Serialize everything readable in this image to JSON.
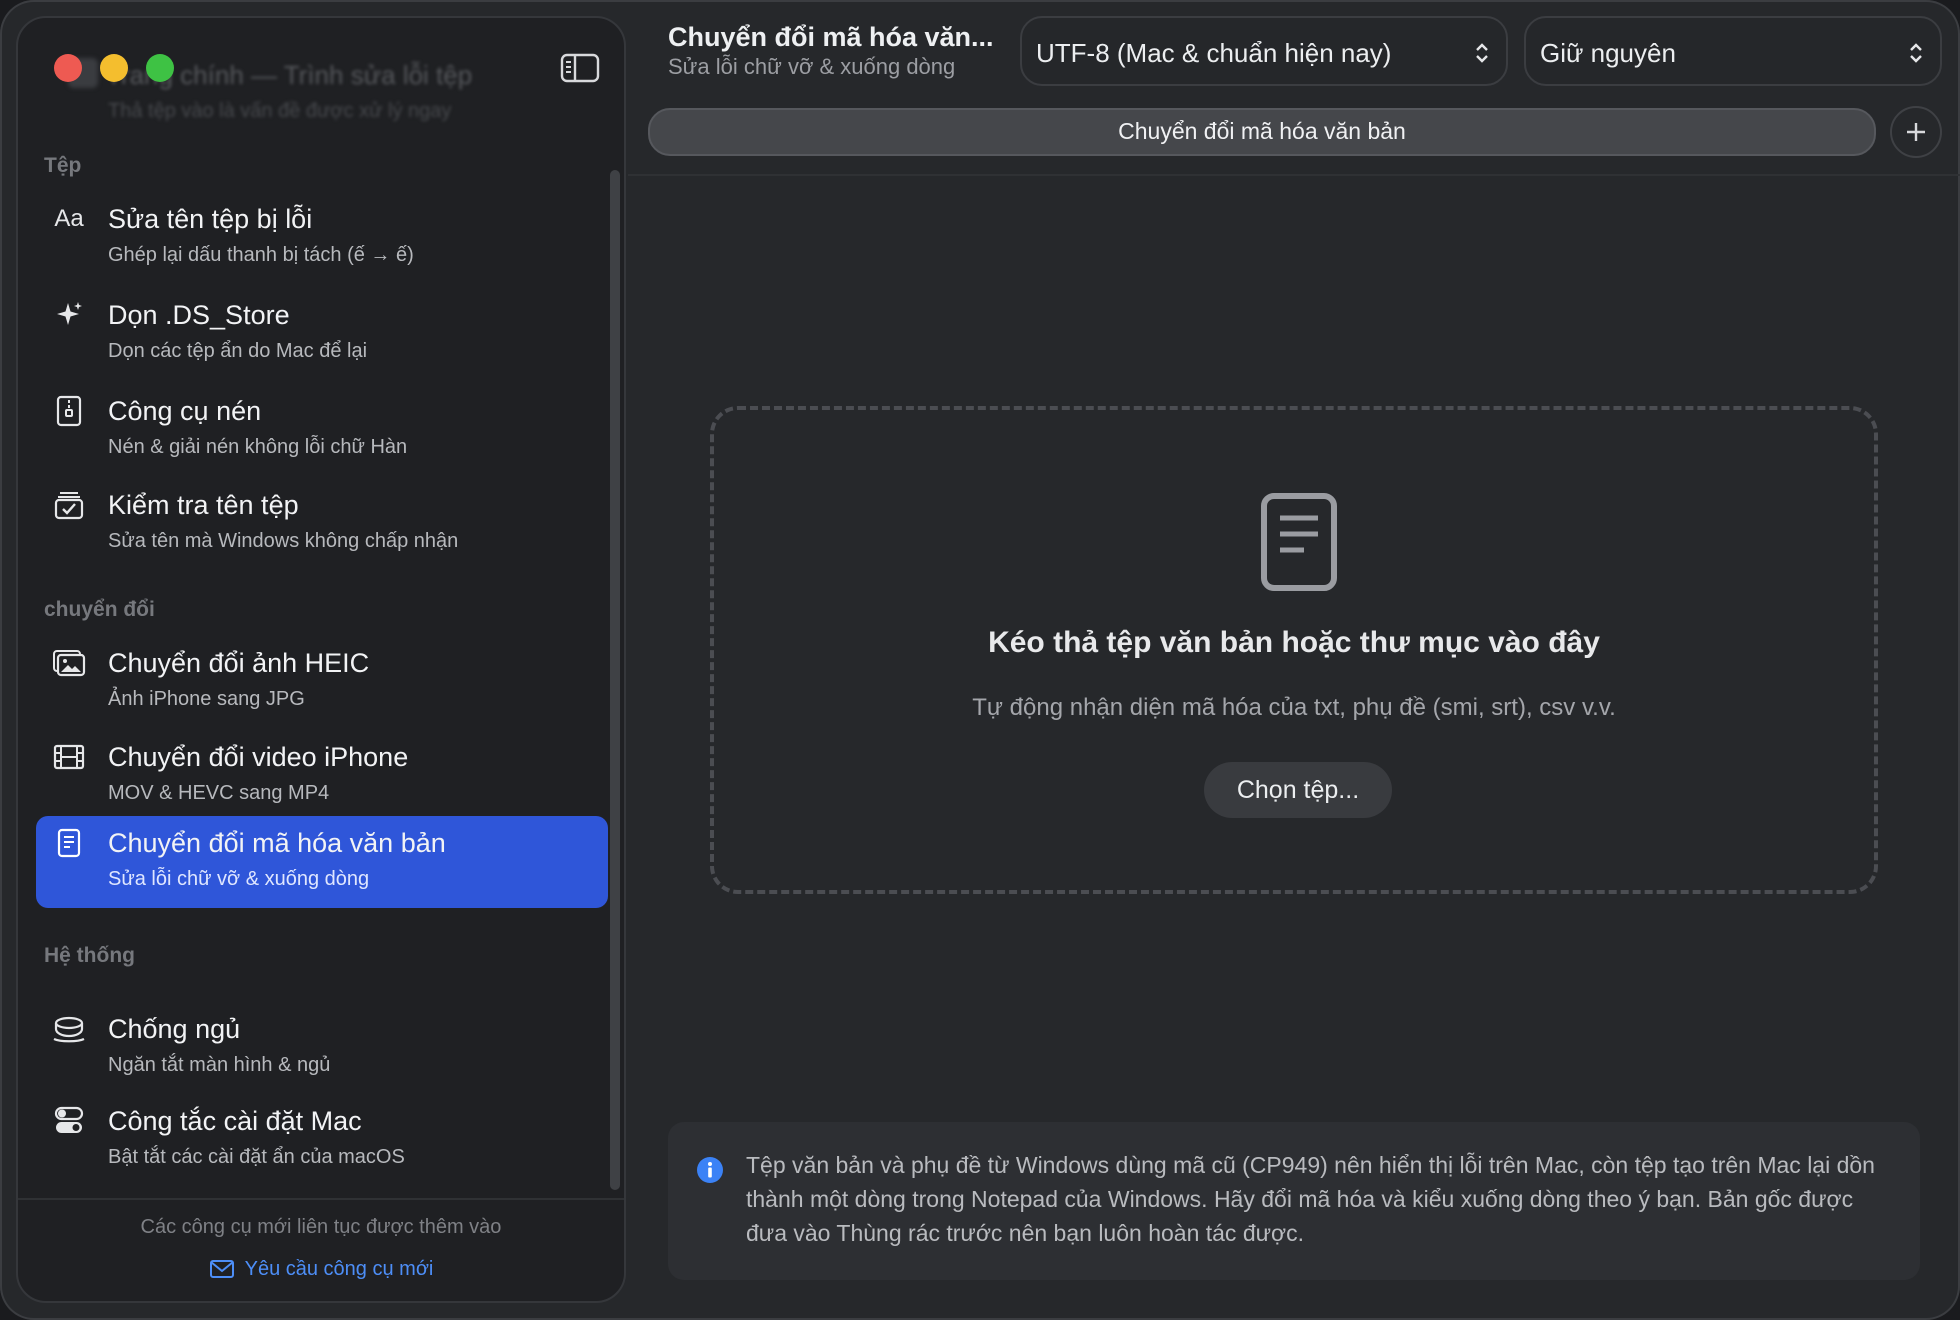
{
  "sidebar": {
    "ghost_title": "Trang chính — Trình sửa lỗi tệp",
    "ghost_subtitle": "Thả tệp vào là vấn đề được xử lý ngay",
    "sections": [
      {
        "label": "Tệp",
        "items": [
          {
            "title": "Sửa tên tệp bị lỗi",
            "subtitle": "Ghép lại dấu thanh bị tách (ế → ế)",
            "icon": "text-format-icon"
          },
          {
            "title": "Dọn .DS_Store",
            "subtitle": "Dọn các tệp ẩn do Mac để lại",
            "icon": "sparkle-icon"
          },
          {
            "title": "Công cụ nén",
            "subtitle": "Nén & giải nén không lỗi chữ Hàn",
            "icon": "zip-file-icon"
          },
          {
            "title": "Kiểm tra tên tệp",
            "subtitle": "Sửa tên mà Windows không chấp nhận",
            "icon": "checkbox-tray-icon"
          }
        ]
      },
      {
        "label": "chuyển đổi",
        "items": [
          {
            "title": "Chuyển đổi ảnh HEIC",
            "subtitle": "Ảnh iPhone sang JPG",
            "icon": "photos-icon"
          },
          {
            "title": "Chuyển đổi video iPhone",
            "subtitle": "MOV & HEVC sang MP4",
            "icon": "film-icon"
          },
          {
            "title": "Chuyển đổi mã hóa văn bản",
            "subtitle": "Sửa lỗi chữ vỡ & xuống dòng",
            "icon": "document-icon",
            "active": true
          }
        ]
      },
      {
        "label": "Hệ thống",
        "items": [
          {
            "title": "Chống ngủ",
            "subtitle": "Ngăn tắt màn hình & ngủ",
            "icon": "cup-icon"
          },
          {
            "title": "Công tắc cài đặt Mac",
            "subtitle": "Bật tắt các cài đặt ẩn của macOS",
            "icon": "toggles-icon"
          }
        ]
      }
    ],
    "footer_note": "Các công cụ mới liên tục được thêm vào",
    "footer_link": "Yêu cầu công cụ mới"
  },
  "header": {
    "title": "Chuyển đổi mã hóa văn...",
    "subtitle": "Sửa lỗi chữ vỡ & xuống dòng",
    "encoding_select": "UTF-8 (Mac & chuẩn hiện nay)",
    "line_ending_select": "Giữ nguyên",
    "tab_label": "Chuyển đổi mã hóa văn bản"
  },
  "dropzone": {
    "title": "Kéo thả tệp văn bản hoặc thư mục vào đây",
    "subtitle": "Tự động nhận diện mã hóa của txt, phụ đề (smi, srt), csv v.v.",
    "button": "Chọn tệp..."
  },
  "info": {
    "text": "Tệp văn bản và phụ đề từ Windows dùng mã cũ (CP949) nên hiển thị lỗi trên Mac, còn tệp tạo trên Mac lại dồn thành một dòng trong Notepad của Windows. Hãy đổi mã hóa và kiểu xuống dòng theo ý bạn. Bản gốc được đưa vào Thùng rác trước nên bạn luôn hoàn tác được."
  },
  "colors": {
    "accent": "#2f56d9",
    "link": "#4d8ef7",
    "close": "#ee5a52",
    "minimize": "#f4be2e",
    "maximize": "#3ec244"
  }
}
